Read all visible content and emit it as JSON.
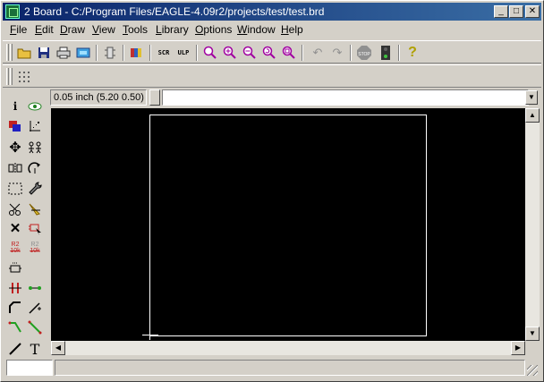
{
  "window": {
    "title": "2 Board - C:/Program Files/EAGLE-4.09r2/projects/test/test.brd",
    "controls": {
      "minimize": "_",
      "maximize": "□",
      "close": "✕"
    }
  },
  "menu": [
    {
      "label": "File",
      "u": "F",
      "rest": "ile"
    },
    {
      "label": "Edit",
      "u": "E",
      "rest": "dit"
    },
    {
      "label": "Draw",
      "u": "D",
      "rest": "raw"
    },
    {
      "label": "View",
      "u": "V",
      "rest": "iew"
    },
    {
      "label": "Tools",
      "u": "T",
      "rest": "ools"
    },
    {
      "label": "Library",
      "u": "L",
      "rest": "ibrary"
    },
    {
      "label": "Options",
      "u": "O",
      "rest": "ptions"
    },
    {
      "label": "Window",
      "u": "W",
      "rest": "indow"
    },
    {
      "label": "Help",
      "u": "H",
      "rest": "elp"
    }
  ],
  "coord_display": "0.05 inch (5.20 0.50)",
  "command_input": {
    "value": ""
  },
  "status": {
    "field": "",
    "message": ""
  },
  "colors": {
    "titlebar_start": "#0a246a",
    "titlebar_end": "#3a6ea5",
    "canvas": "#000000",
    "board_outline": "#ffffff",
    "chrome": "#d4d0c8"
  },
  "toolbar_icons": [
    "open-icon",
    "save-icon",
    "print-icon",
    "cam-icon",
    "script-icon",
    "library-icon",
    "scr-icon",
    "ulp-icon",
    "zoom-fit-icon",
    "zoom-in-icon",
    "zoom-out-icon",
    "zoom-redraw-icon",
    "zoom-select-icon",
    "undo-icon",
    "redo-icon",
    "stop-icon",
    "go-icon",
    "help-icon"
  ],
  "left_tools": {
    "info": "i",
    "text": "T",
    "r2_label_a": "R2",
    "r2_label_b": "10k",
    "r2_label_c": "R2",
    "r2_label_d": "10k"
  },
  "scroll": {
    "up": "▲",
    "down": "▼",
    "left": "◀",
    "right": "▶"
  },
  "toolbar_text": {
    "scr": "SCR",
    "ulp": "ULP",
    "stop": "STOP",
    "help": "?"
  }
}
